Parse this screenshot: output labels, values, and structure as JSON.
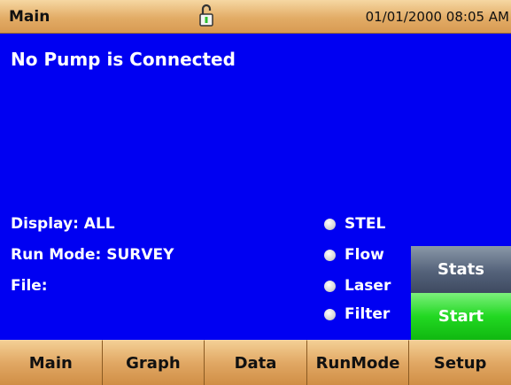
{
  "header": {
    "title": "Main",
    "datetime": "01/01/2000 08:05 AM",
    "lock_icon": "unlocked-padlock-icon"
  },
  "status": {
    "message": "No Pump is Connected"
  },
  "info": {
    "display": "Display: ALL",
    "run_mode": "Run Mode: SURVEY",
    "file": "File:"
  },
  "indicators": [
    {
      "label": "STEL",
      "icon": "status-dot"
    },
    {
      "label": "Flow",
      "icon": "status-dot"
    },
    {
      "label": "Laser",
      "icon": "status-dot"
    },
    {
      "label": "Filter",
      "icon": "status-dot"
    }
  ],
  "side_buttons": {
    "stats": "Stats",
    "start": "Start"
  },
  "nav": [
    {
      "label": "Main"
    },
    {
      "label": "Graph"
    },
    {
      "label": "Data"
    },
    {
      "label": "RunMode"
    },
    {
      "label": "Setup"
    }
  ],
  "colors": {
    "background": "#0000f2",
    "titlebar": "#e2ac66",
    "stats_button": "#54627a",
    "start_button": "#22d822",
    "text": "#ffffff"
  }
}
